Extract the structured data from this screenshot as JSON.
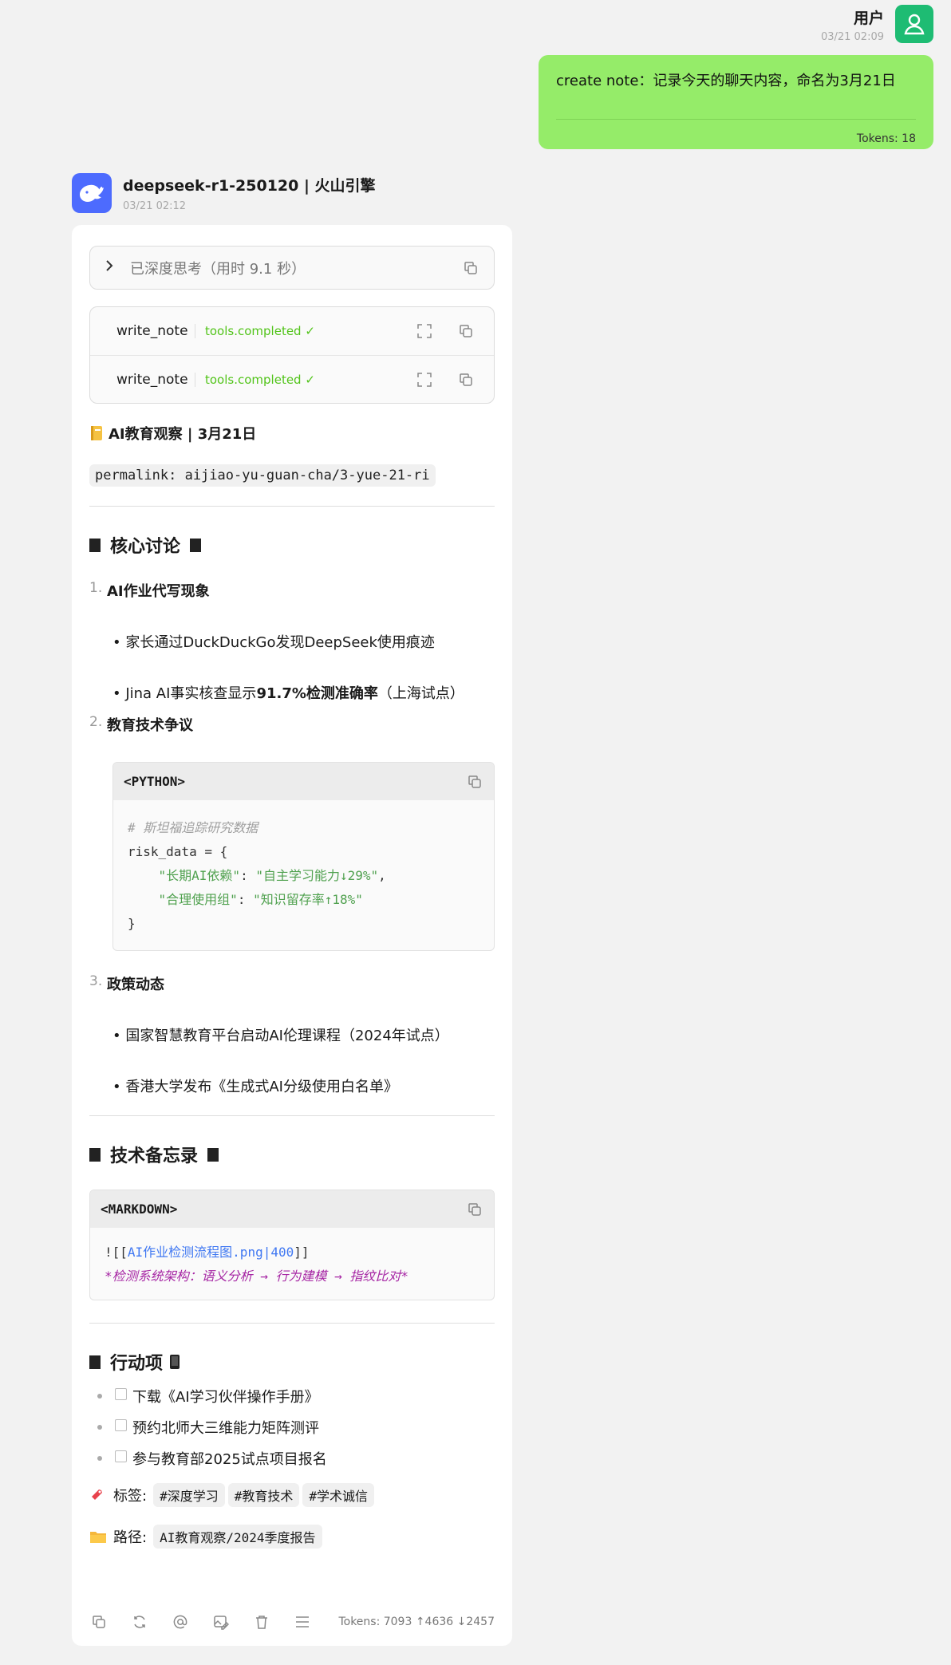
{
  "user": {
    "name": "用户",
    "time": "03/21 02:09",
    "message": "create note：记录今天的聊天内容，命名为3月21日",
    "tokens": "Tokens: 18"
  },
  "assistant": {
    "model": "deepseek-r1-250120 | 火山引擎",
    "time": "03/21 02:12",
    "thinking": "已深度思考（用时 9.1 秒）",
    "tools": [
      {
        "name": "write_note",
        "status": "tools.completed ✓"
      },
      {
        "name": "write_note",
        "status": "tools.completed ✓"
      }
    ],
    "footer_tokens": "Tokens: 7093 ↑4636 ↓2457"
  },
  "note": {
    "title": "AI教育观察 | 3月21日",
    "permalink": "permalink: aijiao-yu-guan-cha/3-yue-21-ri",
    "section1": "核心讨论",
    "items": [
      {
        "num": "1.",
        "title": "AI作业代写现象"
      },
      {
        "num": "2.",
        "title": "教育技术争议"
      },
      {
        "num": "3.",
        "title": "政策动态"
      }
    ],
    "bullet1": "• 家长通过DuckDuckGo发现DeepSeek使用痕迹",
    "bullet2_pre": "• Jina AI事实核查显示",
    "bullet2_bold": "91.7%检测准确率",
    "bullet2_post": "（上海试点）",
    "bullet3": "• 国家智慧教育平台启动AI伦理课程（2024年试点）",
    "bullet4": "• 香港大学发布《生成式AI分级使用白名单》",
    "code1": {
      "lang": "<PYTHON>",
      "comment": "# 斯坦福追踪研究数据",
      "line2": "risk_data = {",
      "key1": "\"长期AI依赖\"",
      "val1": "\"自主学习能力↓29%\"",
      "key2": "\"合理使用组\"",
      "val2": "\"知识留存率↑18%\"",
      "close": "}"
    },
    "section2": "技术备忘录",
    "code2": {
      "lang": "<MARKDOWN>",
      "open": "![[",
      "link": "AI作业检测流程图.png|400",
      "close": "]]",
      "em": "*检测系统架构：语义分析 → 行为建模 → 指纹比对*"
    },
    "section3": "行动项",
    "tasks": [
      "下载《AI学习伙伴操作手册》",
      "预约北师大三维能力矩阵测评",
      "参与教育部2025试点项目报名"
    ],
    "tags_label": "标签:",
    "tags": [
      "#深度学习",
      "#教育技术",
      "#学术诚信"
    ],
    "path_label": "路径:",
    "path": "AI教育观察/2024季度报告"
  }
}
